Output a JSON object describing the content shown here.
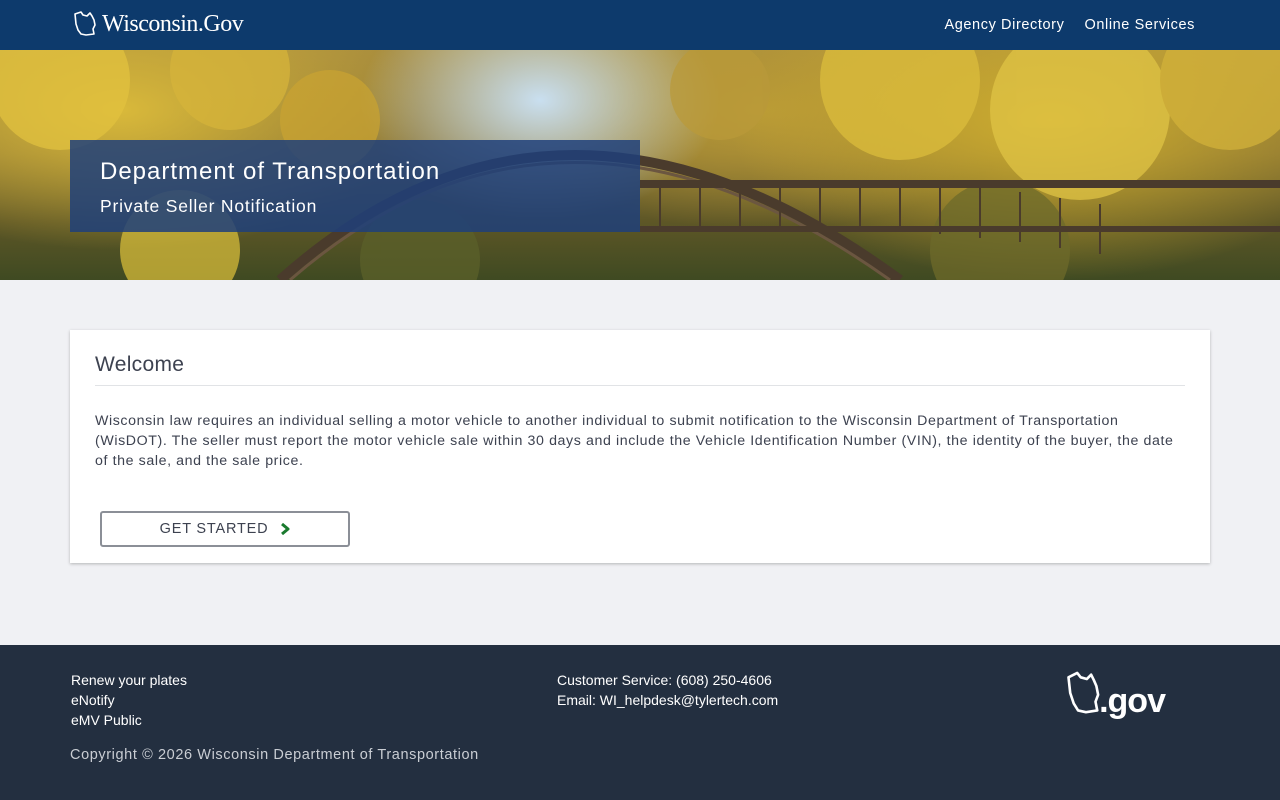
{
  "header": {
    "logo_text": "Wisconsin.Gov",
    "nav": [
      {
        "label": "Agency Directory"
      },
      {
        "label": "Online Services"
      }
    ]
  },
  "hero": {
    "title": "Department of Transportation",
    "subtitle": "Private Seller Notification"
  },
  "welcome": {
    "title": "Welcome",
    "body": "Wisconsin law requires an individual selling a motor vehicle to another individual to submit notification to the Wisconsin Department of Transportation (WisDOT). The seller must report the motor vehicle sale within 30 days and include the Vehicle Identification Number (VIN), the identity of the buyer, the date of the sale, and the sale price.",
    "button_label": "GET STARTED",
    "button_icon": "chevron-right-icon"
  },
  "footer": {
    "links": [
      {
        "label": "Renew your plates"
      },
      {
        "label": "eNotify"
      },
      {
        "label": "eMV Public"
      }
    ],
    "customer_service": "Customer Service: (608) 250-4606",
    "email": "Email: WI_helpdesk@tylertech.com",
    "copyright": "Copyright © 2026 Wisconsin Department of Transportation",
    "logo_text": ".gov"
  },
  "colors": {
    "nav_bg": "#0d3a6c",
    "hero_box_bg": "#1e407a",
    "footer_bg": "#232f40",
    "page_bg": "#f0f1f4",
    "accent_icon": "#1a7a2e"
  }
}
